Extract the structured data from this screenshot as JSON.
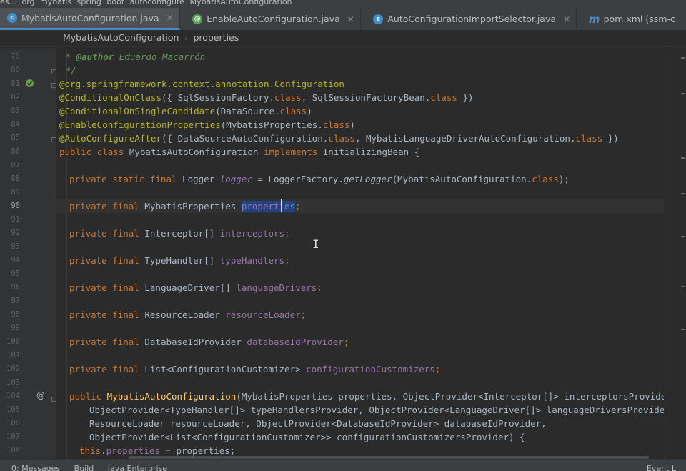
{
  "breadcrumb_top": [
    "es...",
    "org",
    "mybatis",
    "spring",
    "boot",
    "autoconfigure",
    "MybatisAutoConfiguration"
  ],
  "tabs": [
    {
      "label": "MybatisAutoConfiguration.java",
      "icon": "class-icon",
      "active": true
    },
    {
      "label": "EnableAutoConfiguration.java",
      "icon": "annotation-icon",
      "active": false
    },
    {
      "label": "AutoConfigurationImportSelector.java",
      "icon": "class-icon",
      "active": false
    },
    {
      "label": "pom.xml (ssm-c",
      "icon": "maven-icon",
      "active": false
    }
  ],
  "close_glyph": "✕",
  "editor_breadcrumb": {
    "class": "MybatisAutoConfiguration",
    "member": "properties"
  },
  "line_numbers": [
    "79",
    "80",
    "81",
    "82",
    "83",
    "84",
    "85",
    "86",
    "87",
    "88",
    "89",
    "90",
    "91",
    "92",
    "93",
    "94",
    "95",
    "96",
    "97",
    "98",
    "99",
    "100",
    "101",
    "102",
    "103",
    "104",
    "105",
    "106",
    "107",
    "108"
  ],
  "current_line": "90",
  "gutter_markers": {
    "line81": "spring-bean-icon",
    "line104": "@"
  },
  "code": {
    "l79_tag": "@author",
    "l79_text": " Eduardo Macarrón",
    "l80": " */",
    "l81_pkg": "@org.springframework.context.annotation.",
    "l81_ann": "Configuration",
    "l82_ann": "@ConditionalOnClass",
    "l82_a": "({ SqlSessionFactory.",
    "l82_k1": "class",
    "l82_b": ", SqlSessionFactoryBean.",
    "l82_k2": "class",
    "l82_c": " })",
    "l83_ann": "@ConditionalOnSingleCandidate",
    "l83_a": "(DataSource.",
    "l83_k": "class",
    "l83_b": ")",
    "l84_ann": "@EnableConfigurationProperties",
    "l84_a": "(MybatisProperties.",
    "l84_k": "class",
    "l84_b": ")",
    "l85_ann": "@AutoConfigureAfter",
    "l85_a": "({ DataSourceAutoConfiguration.",
    "l85_k1": "class",
    "l85_b": ", MybatisLanguageDriverAutoConfiguration.",
    "l85_k2": "class",
    "l85_c": " })",
    "l86_k1": "public class",
    "l86_a": " MybatisAutoConfiguration ",
    "l86_k2": "implements",
    "l86_b": " InitializingBean {",
    "l88_k": "private static final",
    "l88_a": " Logger ",
    "l88_f": "logger",
    "l88_b": " = LoggerFactory.",
    "l88_m": "getLogger",
    "l88_c": "(MybatisAutoConfiguration.",
    "l88_k2": "class",
    "l88_d": ");",
    "l90_k": "private final",
    "l90_a": " MybatisProperties ",
    "l90_f": "properties",
    "l90_b": ";",
    "l92_k": "private final",
    "l92_a": " Interceptor[] ",
    "l92_f": "interceptors",
    "l92_b": ";",
    "l94_k": "private final",
    "l94_a": " TypeHandler[] ",
    "l94_f": "typeHandlers",
    "l94_b": ";",
    "l96_k": "private final",
    "l96_a": " LanguageDriver[] ",
    "l96_f": "languageDrivers",
    "l96_b": ";",
    "l98_k": "private final",
    "l98_a": " ResourceLoader ",
    "l98_f": "resourceLoader",
    "l98_b": ";",
    "l100_k": "private final",
    "l100_a": " DatabaseIdProvider ",
    "l100_f": "databaseIdProvider",
    "l100_b": ";",
    "l102_k": "private final",
    "l102_a": " List<ConfigurationCustomizer> ",
    "l102_f": "configurationCustomizers",
    "l102_b": ";",
    "l104_k": "public",
    "l104_m": " MybatisAutoConfiguration",
    "l104_a": "(MybatisProperties properties, ObjectProvider<Interceptor[]> interceptorsProvider,",
    "l105": "ObjectProvider<TypeHandler[]> typeHandlersProvider, ObjectProvider<LanguageDriver[]> languageDriversProvider,",
    "l106": "ResourceLoader resourceLoader, ObjectProvider<DatabaseIdProvider> databaseIdProvider,",
    "l107": "ObjectProvider<List<ConfigurationCustomizer>> configurationCustomizersProvider) {",
    "l108_k": "this",
    "l108_a": ".",
    "l108_f": "properties",
    "l108_b": " = properties;"
  },
  "bottom_tools": [
    "0: Messages",
    "Build",
    "Java Enterprise"
  ],
  "bottom_right": "Event L"
}
